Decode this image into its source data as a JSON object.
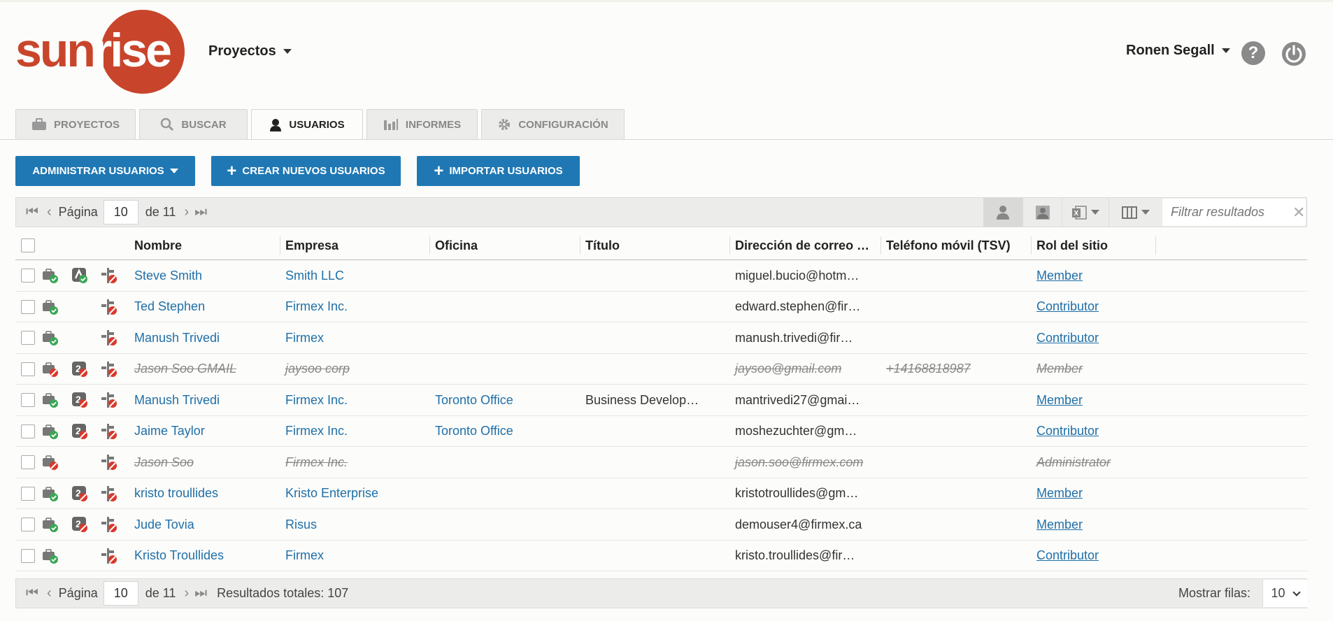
{
  "app": {
    "logo_text_a": "sun",
    "logo_text_b": "rise",
    "projects_menu": "Proyectos",
    "user_name": "Ronen Segall",
    "help_label": "?"
  },
  "colors": {
    "brand": "#c8452c",
    "primary": "#1f78b4",
    "link": "#1f6fa8",
    "ok_badge": "#3aa655",
    "block_badge": "#d9382b"
  },
  "tabs": [
    {
      "label": "PROYECTOS",
      "icon": "briefcase-icon",
      "active": false
    },
    {
      "label": "BUSCAR",
      "icon": "search-icon",
      "active": false
    },
    {
      "label": "USUARIOS",
      "icon": "user-icon",
      "active": true
    },
    {
      "label": "INFORMES",
      "icon": "bar-chart-icon",
      "active": false
    },
    {
      "label": "CONFIGURACIÓN",
      "icon": "gear-icon",
      "active": false
    }
  ],
  "actions": {
    "manage_users": "ADMINISTRAR USUARIOS",
    "create_users": "CREAR NUEVOS USUARIOS",
    "import_users": "IMPORTAR USUARIOS"
  },
  "pager_top": {
    "page_label": "Página",
    "page_value": "10",
    "of_label": "de 11"
  },
  "filter": {
    "placeholder": "Filtrar resultados"
  },
  "table": {
    "columns": [
      "Nombre",
      "Empresa",
      "Oficina",
      "Título",
      "Dirección de correo …",
      "Teléfono móvil (TSV)",
      "Rol del sitio"
    ],
    "rows": [
      {
        "name": "Steve Smith",
        "company": "Smith LLC",
        "office": "",
        "title": "",
        "email": "miguel.bucio@hotm…",
        "phone": "",
        "role": "Member",
        "deleted": false,
        "access": "ok",
        "auth": "alt"
      },
      {
        "name": "Ted Stephen",
        "company": "Firmex Inc.",
        "office": "",
        "title": "",
        "email": "edward.stephen@fir…",
        "phone": "",
        "role": "Contributor",
        "deleted": false,
        "access": "ok",
        "auth": "none"
      },
      {
        "name": "Manush Trivedi",
        "company": "Firmex",
        "office": "",
        "title": "",
        "email": "manush.trivedi@fir…",
        "phone": "",
        "role": "Contributor",
        "deleted": false,
        "access": "ok",
        "auth": "none"
      },
      {
        "name": "Jason Soo GMAIL",
        "company": "jaysoo corp",
        "office": "",
        "title": "",
        "email": "jaysoo@gmail.com",
        "phone": "+14168818987",
        "role": "Member",
        "deleted": true,
        "access": "block",
        "auth": "block"
      },
      {
        "name": "Manush Trivedi",
        "company": "Firmex Inc.",
        "office": "Toronto Office",
        "title": "Business Develop…",
        "email": "mantrivedi27@gmai…",
        "phone": "",
        "role": "Member",
        "deleted": false,
        "access": "ok",
        "auth": "block"
      },
      {
        "name": "Jaime Taylor",
        "company": "Firmex Inc.",
        "office": "Toronto Office",
        "title": "",
        "email": "moshezuchter@gm…",
        "phone": "",
        "role": "Contributor",
        "deleted": false,
        "access": "ok",
        "auth": "block"
      },
      {
        "name": "Jason Soo",
        "company": "Firmex Inc.",
        "office": "",
        "title": "",
        "email": "jason.soo@firmex.com",
        "phone": "",
        "role": "Administrator",
        "deleted": true,
        "access": "block",
        "auth": "none"
      },
      {
        "name": "kristo troullides",
        "company": "Kristo Enterprise",
        "office": "",
        "title": "",
        "email": "kristotroullides@gm…",
        "phone": "",
        "role": "Member",
        "deleted": false,
        "access": "ok",
        "auth": "block"
      },
      {
        "name": "Jude Tovia",
        "company": "Risus",
        "office": "",
        "title": "",
        "email": "demouser4@firmex.ca",
        "phone": "",
        "role": "Member",
        "deleted": false,
        "access": "ok",
        "auth": "block"
      },
      {
        "name": "Kristo Troullides",
        "company": "Firmex",
        "office": "",
        "title": "",
        "email": "kristo.troullides@fir…",
        "phone": "",
        "role": "Contributor",
        "deleted": false,
        "access": "ok",
        "auth": "none"
      }
    ]
  },
  "pager_bottom": {
    "page_label": "Página",
    "page_value": "10",
    "of_label": "de 11",
    "total_label": "Resultados totales: 107",
    "rows_label": "Mostrar filas:",
    "rows_value": "10"
  }
}
